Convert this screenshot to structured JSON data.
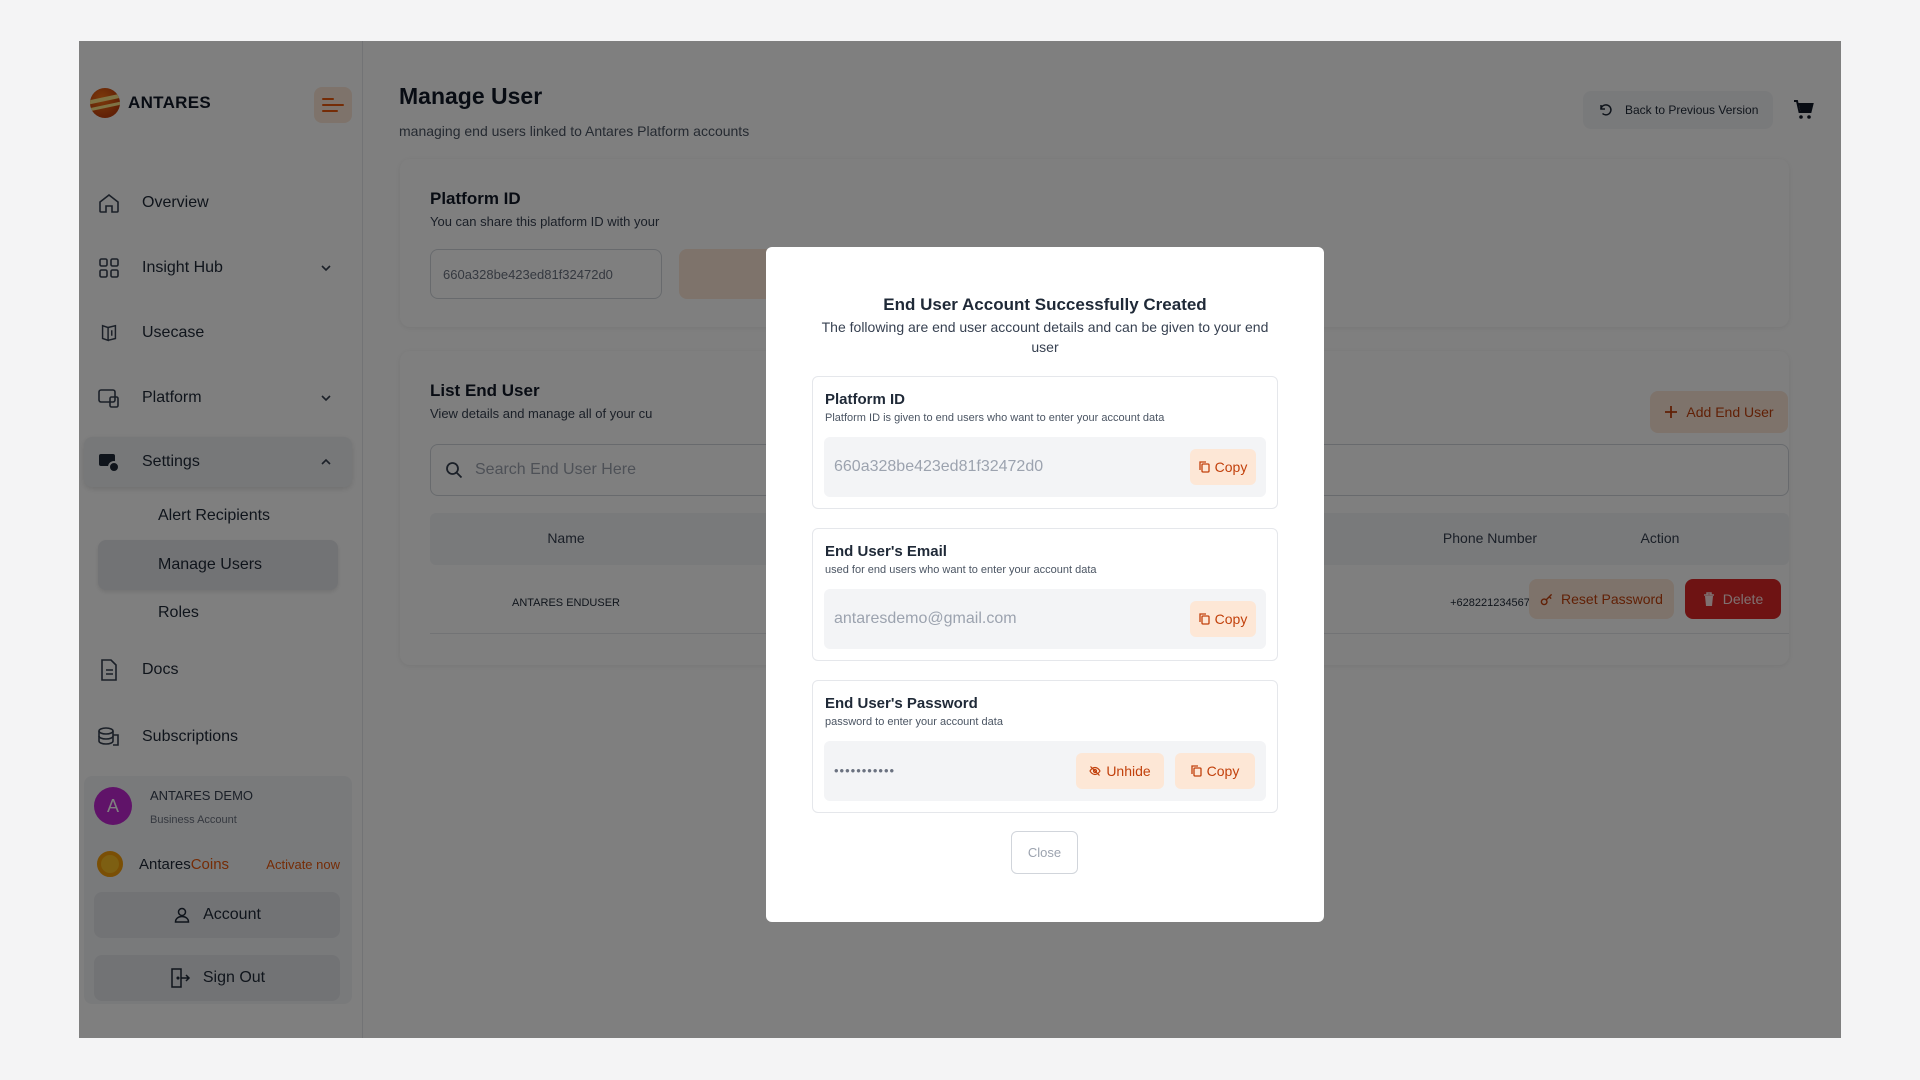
{
  "sidebar": {
    "brand": "ANTARES",
    "items": [
      {
        "label": "Overview",
        "icon": "home-icon"
      },
      {
        "label": "Insight Hub",
        "icon": "grid-icon"
      },
      {
        "label": "Usecase",
        "icon": "usecase-icon"
      },
      {
        "label": "Platform",
        "icon": "platform-icon"
      },
      {
        "label": "Settings",
        "icon": "settings-icon"
      },
      {
        "label": "Docs",
        "icon": "document-icon"
      },
      {
        "label": "Subscriptions",
        "icon": "coins-stack-icon"
      }
    ],
    "settings_sub": [
      "Alert Recipients",
      "Manage Users",
      "Roles"
    ],
    "user": {
      "initial": "A",
      "name": "ANTARES DEMO",
      "type": "Business Account"
    },
    "coins": {
      "prefix": "Antares",
      "accent": "Coins",
      "activate": "Activate now"
    },
    "account_label": "Account",
    "signout_label": "Sign Out"
  },
  "header": {
    "title": "Manage User",
    "subtitle": "managing end users linked to Antares Platform accounts",
    "back_label": "Back to Previous Version"
  },
  "platform_card": {
    "title": "Platform ID",
    "subtitle": "You can share this platform ID with your",
    "value": "660a328be423ed81f32472d0"
  },
  "list_card": {
    "title": "List End User",
    "subtitle": "View details and manage all of your cu",
    "add_label": "Add End User",
    "search_placeholder": "Search End User Here",
    "columns": {
      "name": "Name",
      "phone": "Phone Number",
      "action": "Action"
    },
    "rows": [
      {
        "name": "ANTARES ENDUSER",
        "phone": "+628221234567",
        "reset": "Reset Password",
        "delete": "Delete"
      }
    ]
  },
  "modal": {
    "title": "End User Account Successfully Created",
    "subtitle": "The following are end user account details and can be given to your end user",
    "platform": {
      "title": "Platform ID",
      "desc": "Platform ID is given to end users who want to enter your account data",
      "value": "660a328be423ed81f32472d0",
      "copy": "Copy"
    },
    "email": {
      "title": "End User's Email",
      "desc": "used for end users who want to enter your account data",
      "value": "antaresdemo@gmail.com",
      "copy": "Copy"
    },
    "password": {
      "title": "End User's Password",
      "desc": "password to enter your account data",
      "value": "•••••••••••",
      "unhide": "Unhide",
      "copy": "Copy"
    },
    "close_label": "Close"
  },
  "colors": {
    "accent": "#ea580c",
    "accent_bg": "#fde7d6",
    "danger": "#dc2626",
    "avatar": "#c026d3"
  }
}
